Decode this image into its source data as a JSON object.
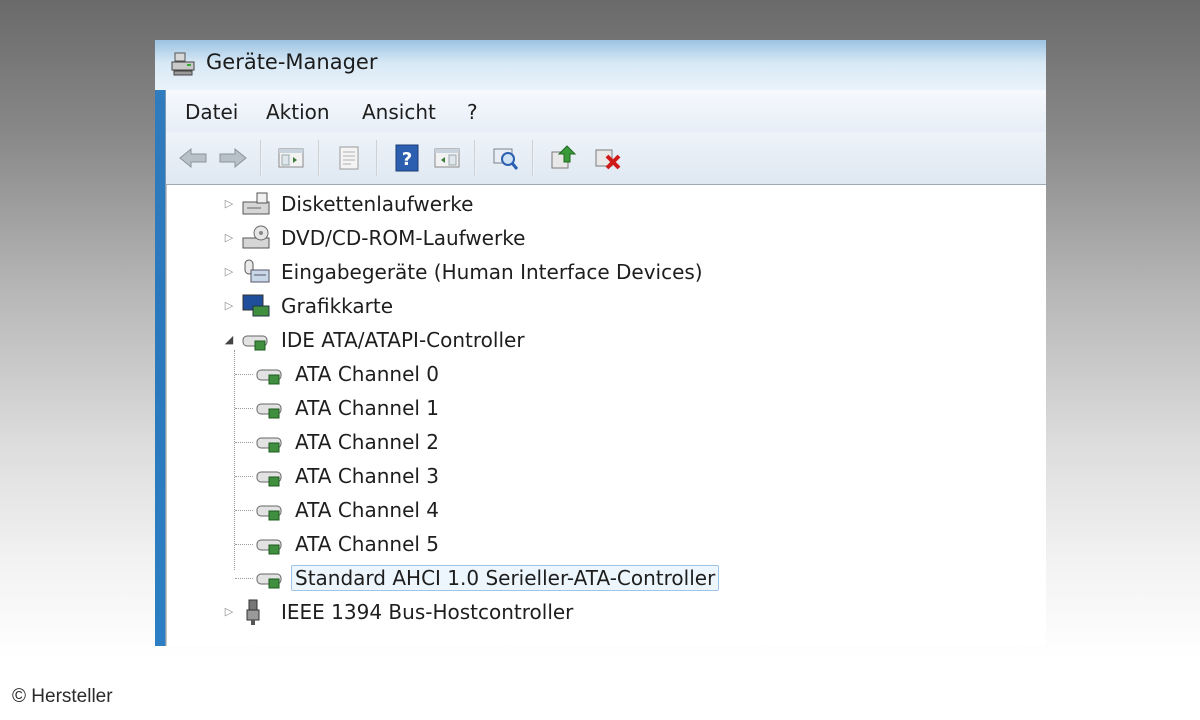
{
  "window": {
    "title": "Geräte-Manager"
  },
  "menu": [
    {
      "label": "Datei"
    },
    {
      "label": "Aktion"
    },
    {
      "label": "Ansicht"
    },
    {
      "label": "?"
    }
  ],
  "toolbar": {
    "buttons": [
      {
        "icon": "back-arrow-icon"
      },
      {
        "icon": "forward-arrow-icon"
      },
      {
        "icon": "show-hide-console-tree-icon"
      },
      {
        "icon": "properties-sheet-icon"
      },
      {
        "icon": "help-icon"
      },
      {
        "icon": "show-action-pane-icon"
      },
      {
        "icon": "scan-hardware-icon"
      },
      {
        "icon": "update-driver-icon"
      },
      {
        "icon": "uninstall-device-icon"
      }
    ]
  },
  "tree": {
    "categories": [
      {
        "label": "Diskettenlaufwerke",
        "icon": "floppy-drive-icon",
        "expanded": false
      },
      {
        "label": "DVD/CD-ROM-Laufwerke",
        "icon": "optical-drive-icon",
        "expanded": false
      },
      {
        "label": "Eingabegeräte (Human Interface Devices)",
        "icon": "hid-device-icon",
        "expanded": false
      },
      {
        "label": "Grafikkarte",
        "icon": "display-adapter-icon",
        "expanded": false
      },
      {
        "label": "IDE ATA/ATAPI-Controller",
        "icon": "ide-controller-icon",
        "expanded": true
      },
      {
        "label": "IEEE 1394 Bus-Hostcontroller",
        "icon": "ieee1394-icon",
        "expanded": false
      }
    ],
    "ide_children": [
      {
        "label": "ATA Channel 0"
      },
      {
        "label": "ATA Channel 1"
      },
      {
        "label": "ATA Channel 2"
      },
      {
        "label": "ATA Channel 3"
      },
      {
        "label": "ATA Channel 4"
      },
      {
        "label": "ATA Channel 5"
      },
      {
        "label": "Standard AHCI 1.0 Serieller-ATA-Controller",
        "selected": true
      }
    ]
  },
  "credit": "© Hersteller"
}
